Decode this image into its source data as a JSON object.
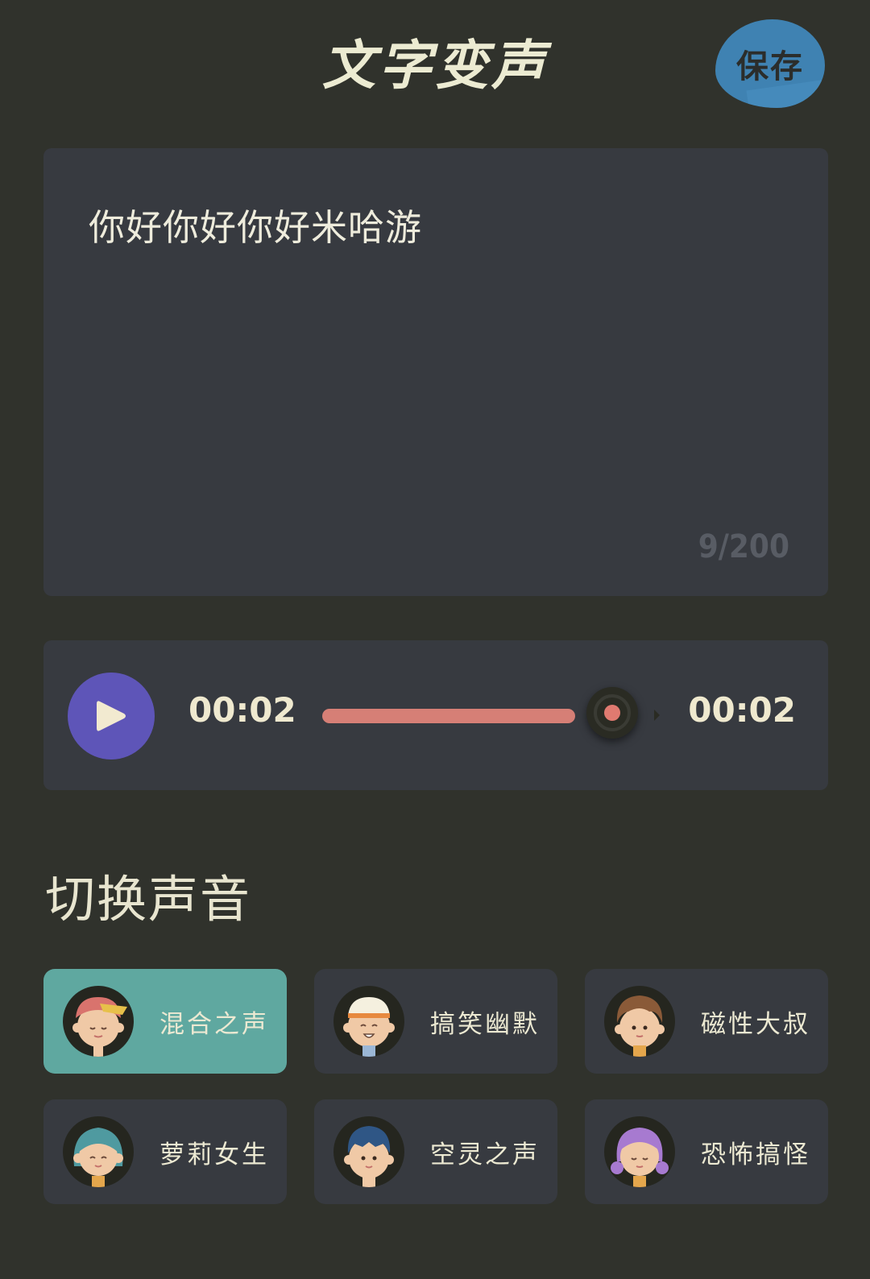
{
  "header": {
    "title": "文字变声",
    "save_label": "保存"
  },
  "editor": {
    "text": "你好你好你好米哈游",
    "char_count": "9/200"
  },
  "player": {
    "current_time": "00:02",
    "total_time": "00:02",
    "progress": 1.0,
    "play_icon": "play-icon"
  },
  "voices": {
    "title": "切换声音",
    "items": [
      {
        "label": "混合之声",
        "selected": true,
        "avatar": "avatar-girl-bandana"
      },
      {
        "label": "搞笑幽默",
        "selected": false,
        "avatar": "avatar-boy-cap"
      },
      {
        "label": "磁性大叔",
        "selected": false,
        "avatar": "avatar-man-brown-hair"
      },
      {
        "label": "萝莉女生",
        "selected": false,
        "avatar": "avatar-girl-teal-hair"
      },
      {
        "label": "空灵之声",
        "selected": false,
        "avatar": "avatar-boy-blue-hair"
      },
      {
        "label": "恐怖搞怪",
        "selected": false,
        "avatar": "avatar-girl-purple-hair"
      }
    ]
  },
  "colors": {
    "background": "#30322c",
    "card": "#373a40",
    "accent_selected": "#5fa8a0",
    "play_button": "#5e55b8",
    "progress": "#d67f76",
    "save_button": "#3f82b2"
  }
}
